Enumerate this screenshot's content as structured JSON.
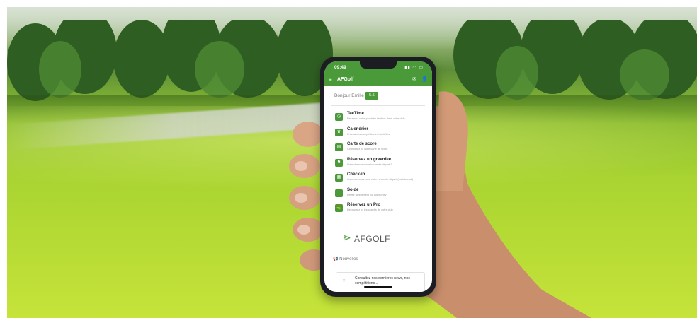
{
  "status_bar": {
    "time": "09:49"
  },
  "app_bar": {
    "title": "AFGolf"
  },
  "greeting": {
    "text": "Bonjour Emilie",
    "handicap": "5.5"
  },
  "menu_items": [
    {
      "title": "TeeTime",
      "subtitle": "Réservez votre prochain teetime dans votre club",
      "icon": "clock-icon"
    },
    {
      "title": "Calendrier",
      "subtitle": "Prochaines compétitions et activités",
      "icon": "trophy-icon"
    },
    {
      "title": "Carte de score",
      "subtitle": "Complétez ici votre carte de score",
      "icon": "scorecard-icon"
    },
    {
      "title": "Réservez un greenfee",
      "subtitle": "Vous cherchez une heure de départ ?",
      "icon": "flag-icon"
    },
    {
      "title": "Check-in",
      "subtitle": "Inscrivez-vous pour votre heure de départ (mobile/club)",
      "icon": "checkin-icon"
    },
    {
      "title": "Solde",
      "subtitle": "Payez simplement via BB money",
      "icon": "plus-icon"
    },
    {
      "title": "Réservez un Pro",
      "subtitle": "Découvrez ici les coachs de votre club",
      "icon": "pro-icon"
    }
  ],
  "logo": {
    "text": "AFGOLF"
  },
  "news": {
    "heading": "Nouvelles",
    "card_text": "Consultez nos dernières news, nos compétitions..."
  },
  "colors": {
    "brand_green": "#4b9a3a"
  }
}
